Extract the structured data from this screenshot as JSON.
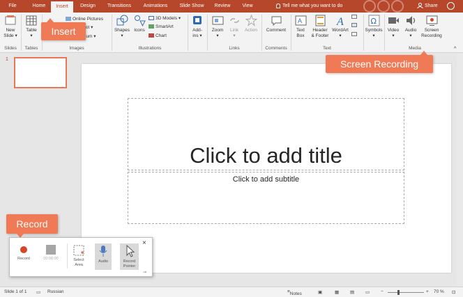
{
  "tabs": [
    {
      "label": "File"
    },
    {
      "label": "Home"
    },
    {
      "label": "Insert"
    },
    {
      "label": "Design"
    },
    {
      "label": "Transitions"
    },
    {
      "label": "Animations"
    },
    {
      "label": "Slide Show"
    },
    {
      "label": "Review"
    },
    {
      "label": "View"
    }
  ],
  "tell_me": "Tell me what you want to do",
  "share": "Share",
  "ribbon": {
    "new_slide": [
      "New",
      "Slide"
    ],
    "table": "Table",
    "online_pictures": "Online Pictures",
    "screenshot": "shot",
    "album": "Album",
    "shapes": "Shapes",
    "icons": "Icons",
    "models_3d": "3D Models",
    "smartart": "SmartArt",
    "chart": "Chart",
    "addins": [
      "Add-",
      "ins"
    ],
    "zoom": "Zoom",
    "link": "Link",
    "action": "Action",
    "comment": "Comment",
    "text_box": [
      "Text",
      "Box"
    ],
    "header_footer": [
      "Header",
      "& Footer"
    ],
    "wordart": "WordArt",
    "symbols": "Symbols",
    "video": "Video",
    "audio": "Audio",
    "screen_recording": [
      "Screen",
      "Recording"
    ],
    "groups": {
      "slides": "Slides",
      "tables": "Tables",
      "images": "Images",
      "illustrations": "Illustrations",
      "links": "Links",
      "comments": "Comments",
      "text": "Text",
      "media": "Media"
    }
  },
  "thumbnails": [
    {
      "number": "1"
    }
  ],
  "slide": {
    "title_placeholder": "Click to add title",
    "subtitle_placeholder": "Click to add subtitle"
  },
  "callouts": {
    "insert": "Insert",
    "screen_recording": "Screen Recording",
    "record": "Record"
  },
  "record_panel": {
    "record": "Record",
    "time": "00:00:00",
    "select_area": [
      "Select",
      "Area"
    ],
    "audio": "Audio",
    "record_pointer": [
      "Record",
      "Pointer"
    ],
    "close": "×"
  },
  "status": {
    "slide": "Slide 1 of 1",
    "language": "Russian",
    "notes": "Notes",
    "zoom": "70 %"
  },
  "colors": {
    "accent": "#b7472a",
    "callout": "#f07a55",
    "record_red": "#d24726"
  }
}
